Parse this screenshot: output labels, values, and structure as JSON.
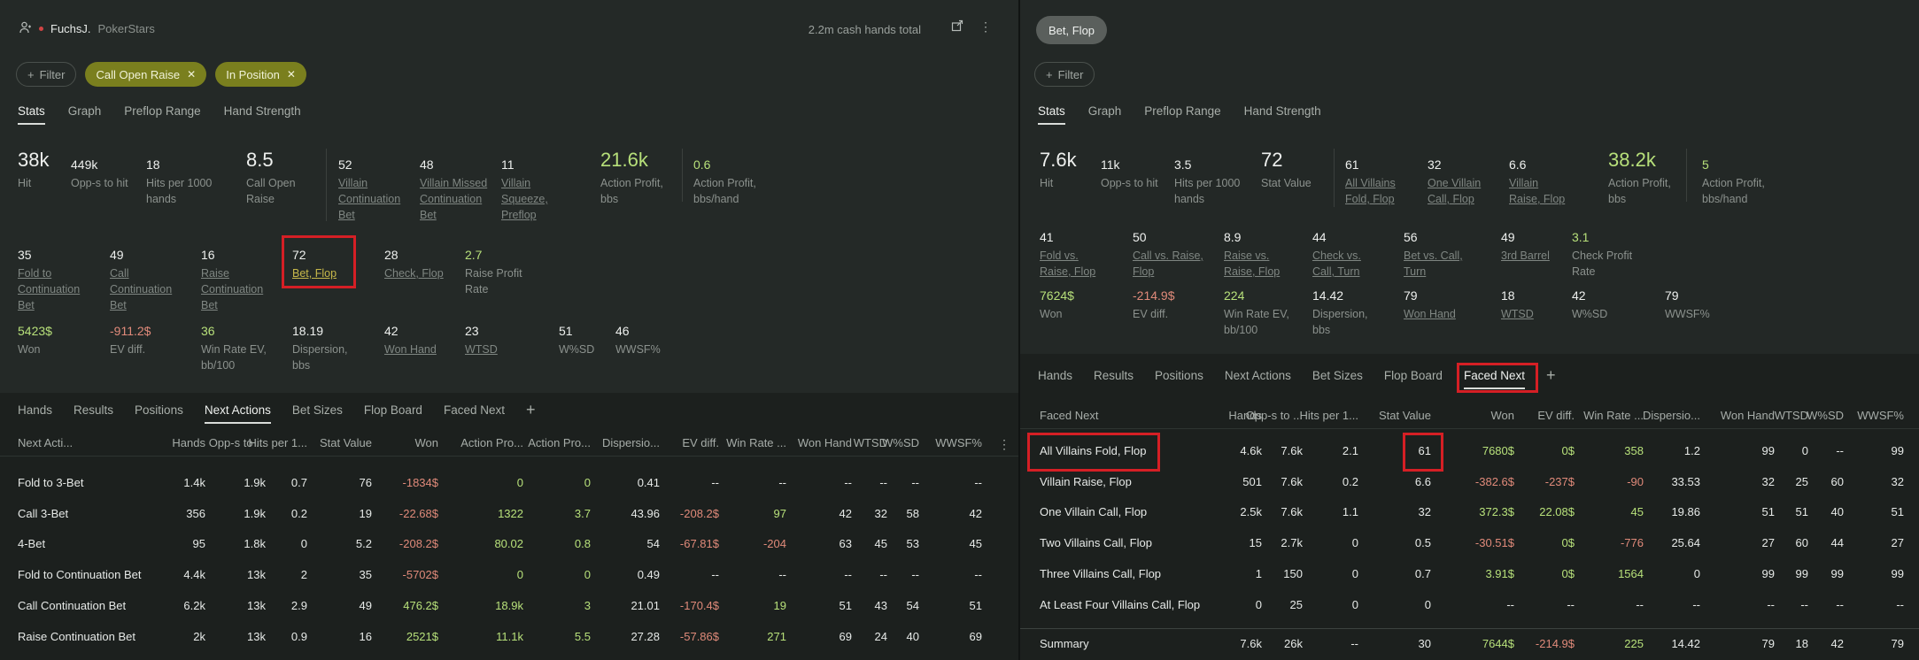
{
  "left": {
    "player_name": "FuchsJ.",
    "player_site": "PokerStars",
    "hands_total": "2.2m cash hands total",
    "filter_label": "Filter",
    "chips": [
      "Call Open Raise",
      "In Position"
    ],
    "tabs": [
      "Stats",
      "Graph",
      "Preflop Range",
      "Hand Strength"
    ],
    "stats_row1": [
      {
        "v": "38k",
        "l": "Hit"
      },
      {
        "v": "449k",
        "l": "Opp-s to hit"
      },
      {
        "v": "18",
        "l": "Hits per 1000 hands"
      },
      {
        "v": "8.5",
        "l": "Call Open Raise"
      },
      {
        "v": "52",
        "l": "Villain Continuation Bet"
      },
      {
        "v": "48",
        "l": "Villain Missed Continuation Bet"
      },
      {
        "v": "11",
        "l": "Villain Squeeze, Preflop"
      },
      {
        "v": "21.6k",
        "l": "Action Profit, bbs"
      },
      {
        "v": "0.6",
        "l": "Action Profit, bbs/hand"
      }
    ],
    "stats_row2": [
      {
        "v": "35",
        "l": "Fold to Continuation Bet"
      },
      {
        "v": "49",
        "l": "Call Continuation Bet"
      },
      {
        "v": "16",
        "l": "Raise Continuation Bet"
      },
      {
        "v": "72",
        "l": "Bet, Flop"
      },
      {
        "v": "28",
        "l": "Check, Flop"
      },
      {
        "v": "2.7",
        "l": "Raise Profit Rate"
      }
    ],
    "stats_row3": [
      {
        "v": "5423$",
        "l": "Won"
      },
      {
        "v": "-911.2$",
        "l": "EV diff."
      },
      {
        "v": "36",
        "l": "Win Rate EV, bb/100"
      },
      {
        "v": "18.19",
        "l": "Dispersion, bbs"
      },
      {
        "v": "42",
        "l": "Won Hand"
      },
      {
        "v": "23",
        "l": "WTSD"
      },
      {
        "v": "51",
        "l": "W%SD"
      },
      {
        "v": "46",
        "l": "WWSF%"
      }
    ],
    "bottom_tabs": [
      "Hands",
      "Results",
      "Positions",
      "Next Actions",
      "Bet Sizes",
      "Flop Board",
      "Faced Next"
    ],
    "table_headers": [
      "Next Acti...",
      "Hands",
      "Opp-s to ...",
      "Hits per 1...",
      "Stat Value",
      "Won",
      "Action Pro...",
      "Action Pro...",
      "Dispersio...",
      "EV diff.",
      "Win Rate ...",
      "Won Hand",
      "WTSD",
      "W%SD",
      "WWSF%"
    ],
    "rows": [
      [
        "Fold to 3-Bet",
        "1.4k",
        "1.9k",
        "0.7",
        "76",
        "-1834$",
        "0",
        "0",
        "0.41",
        "--",
        "--",
        "--",
        "--",
        "--",
        "--"
      ],
      [
        "Call 3-Bet",
        "356",
        "1.9k",
        "0.2",
        "19",
        "-22.68$",
        "1322",
        "3.7",
        "43.96",
        "-208.2$",
        "97",
        "42",
        "32",
        "58",
        "42"
      ],
      [
        "4-Bet",
        "95",
        "1.8k",
        "0",
        "5.2",
        "-208.2$",
        "80.02",
        "0.8",
        "54",
        "-67.81$",
        "-204",
        "63",
        "45",
        "53",
        "45"
      ],
      [
        "Fold to Continuation Bet",
        "4.4k",
        "13k",
        "2",
        "35",
        "-5702$",
        "0",
        "0",
        "0.49",
        "--",
        "--",
        "--",
        "--",
        "--",
        "--"
      ],
      [
        "Call Continuation Bet",
        "6.2k",
        "13k",
        "2.9",
        "49",
        "476.2$",
        "18.9k",
        "3",
        "21.01",
        "-170.4$",
        "19",
        "51",
        "43",
        "54",
        "51"
      ],
      [
        "Raise Continuation Bet",
        "2k",
        "13k",
        "0.9",
        "16",
        "2521$",
        "11.1k",
        "5.5",
        "27.28",
        "-57.86$",
        "271",
        "69",
        "24",
        "40",
        "69"
      ]
    ]
  },
  "right": {
    "badge": "Bet, Flop",
    "filter_label": "Filter",
    "tabs": [
      "Stats",
      "Graph",
      "Preflop Range",
      "Hand Strength"
    ],
    "stats_row1": [
      {
        "v": "7.6k",
        "l": "Hit"
      },
      {
        "v": "11k",
        "l": "Opp-s to hit"
      },
      {
        "v": "3.5",
        "l": "Hits per 1000 hands"
      },
      {
        "v": "72",
        "l": "Stat Value"
      },
      {
        "v": "61",
        "l": "All Villains Fold, Flop"
      },
      {
        "v": "32",
        "l": "One Villain Call, Flop"
      },
      {
        "v": "6.6",
        "l": "Villain Raise, Flop"
      },
      {
        "v": "38.2k",
        "l": "Action Profit, bbs"
      },
      {
        "v": "5",
        "l": "Action Profit, bbs/hand"
      }
    ],
    "stats_row2": [
      {
        "v": "41",
        "l": "Fold vs. Raise, Flop"
      },
      {
        "v": "50",
        "l": "Call vs. Raise, Flop"
      },
      {
        "v": "8.9",
        "l": "Raise vs. Raise, Flop"
      },
      {
        "v": "44",
        "l": "Check vs. Call, Turn"
      },
      {
        "v": "56",
        "l": "Bet vs. Call, Turn"
      },
      {
        "v": "49",
        "l": "3rd Barrel"
      },
      {
        "v": "3.1",
        "l": "Check Profit Rate"
      }
    ],
    "stats_row3": [
      {
        "v": "7624$",
        "l": "Won"
      },
      {
        "v": "-214.9$",
        "l": "EV diff."
      },
      {
        "v": "224",
        "l": "Win Rate EV, bb/100"
      },
      {
        "v": "14.42",
        "l": "Dispersion, bbs"
      },
      {
        "v": "79",
        "l": "Won Hand"
      },
      {
        "v": "18",
        "l": "WTSD"
      },
      {
        "v": "42",
        "l": "W%SD"
      },
      {
        "v": "79",
        "l": "WWSF%"
      }
    ],
    "bottom_tabs": [
      "Hands",
      "Results",
      "Positions",
      "Next Actions",
      "Bet Sizes",
      "Flop Board",
      "Faced Next"
    ],
    "table_headers": [
      "Faced Next",
      "Hands",
      "Opp-s to ...",
      "Hits per 1...",
      "Stat Value",
      "Won",
      "EV diff.",
      "Win Rate ...",
      "Dispersio...",
      "Won Hand",
      "WTSD",
      "W%SD",
      "WWSF%"
    ],
    "rows": [
      [
        "All Villains Fold, Flop",
        "4.6k",
        "7.6k",
        "2.1",
        "61",
        "7680$",
        "0$",
        "358",
        "1.2",
        "99",
        "0",
        "--",
        "99"
      ],
      [
        "Villain Raise, Flop",
        "501",
        "7.6k",
        "0.2",
        "6.6",
        "-382.6$",
        "-237$",
        "-90",
        "33.53",
        "32",
        "25",
        "60",
        "32"
      ],
      [
        "One Villain Call, Flop",
        "2.5k",
        "7.6k",
        "1.1",
        "32",
        "372.3$",
        "22.08$",
        "45",
        "19.86",
        "51",
        "51",
        "40",
        "51"
      ],
      [
        "Two Villains Call, Flop",
        "15",
        "2.7k",
        "0",
        "0.5",
        "-30.51$",
        "0$",
        "-776",
        "25.64",
        "27",
        "60",
        "44",
        "27"
      ],
      [
        "Three Villains Call, Flop",
        "1",
        "150",
        "0",
        "0.7",
        "3.91$",
        "0$",
        "1564",
        "0",
        "99",
        "99",
        "99",
        "99"
      ],
      [
        "At Least Four Villains Call, Flop",
        "0",
        "25",
        "0",
        "0",
        "--",
        "--",
        "--",
        "--",
        "--",
        "--",
        "--",
        "--"
      ]
    ],
    "summary": [
      "Summary",
      "7.6k",
      "26k",
      "--",
      "30",
      "7644$",
      "-214.9$",
      "225",
      "14.42",
      "79",
      "18",
      "42",
      "79"
    ]
  }
}
